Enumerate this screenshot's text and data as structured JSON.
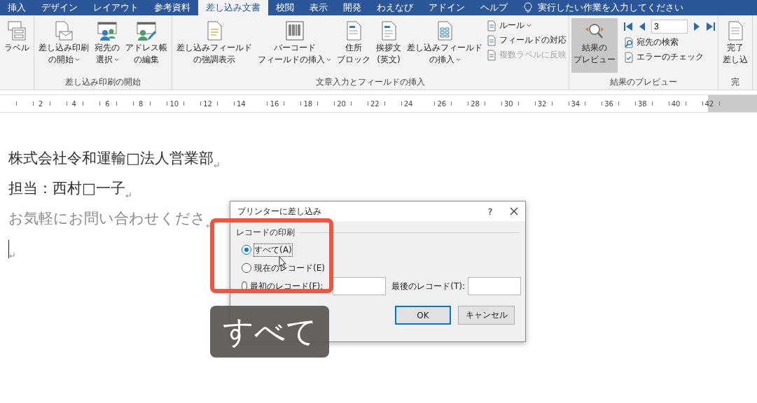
{
  "tabs": [
    {
      "label": "挿入",
      "selected": false
    },
    {
      "label": "デザイン",
      "selected": false
    },
    {
      "label": "レイアウト",
      "selected": false
    },
    {
      "label": "参考資料",
      "selected": false
    },
    {
      "label": "差し込み文書",
      "selected": true
    },
    {
      "label": "校閲",
      "selected": false
    },
    {
      "label": "表示",
      "selected": false
    },
    {
      "label": "開発",
      "selected": false
    },
    {
      "label": "わえなび",
      "selected": false
    },
    {
      "label": "アドイン",
      "selected": false
    },
    {
      "label": "ヘルプ",
      "selected": false
    }
  ],
  "tell_me": "実行したい作業を入力してください",
  "ribbon": [
    {
      "items": [
        {
          "kind": "large",
          "lines": [
            "ラベル"
          ],
          "dropdown": false,
          "pressed": false
        }
      ]
    },
    {
      "label": "差し込み印刷の開始",
      "items": [
        {
          "kind": "large",
          "lines": [
            "差し込み印刷",
            "の開始"
          ],
          "dropdown": true,
          "pressed": false
        },
        {
          "kind": "large",
          "lines": [
            "宛先の",
            "選択"
          ],
          "dropdown": true,
          "pressed": false
        },
        {
          "kind": "large",
          "lines": [
            "アドレス帳",
            "の編集"
          ],
          "dropdown": false,
          "pressed": false
        }
      ]
    },
    {
      "label": "文章入力とフィールドの挿入",
      "items": [
        {
          "kind": "large",
          "lines": [
            "差し込みフィールド",
            "の強調表示"
          ],
          "dropdown": false,
          "pressed": false
        },
        {
          "kind": "large",
          "lines": [
            "バーコード",
            "フィールドの挿入"
          ],
          "dropdown": true,
          "pressed": false
        },
        {
          "kind": "large",
          "lines": [
            "住所",
            "ブロック"
          ],
          "dropdown": false,
          "pressed": false
        },
        {
          "kind": "large",
          "lines": [
            "挨拶文",
            "(英文)"
          ],
          "dropdown": false,
          "pressed": false
        },
        {
          "kind": "large",
          "lines": [
            "差し込みフィールド",
            "の挿入"
          ],
          "dropdown": true,
          "pressed": false
        },
        {
          "kind": "small",
          "entries": [
            {
              "label": "ルール",
              "dropdown": true,
              "disabled": false
            },
            {
              "label": "フィールドの対応",
              "dropdown": false,
              "disabled": false
            },
            {
              "label": "複数ラベルに反映",
              "dropdown": false,
              "disabled": true
            }
          ]
        }
      ]
    },
    {
      "label": "結果のプレビュー",
      "items": [
        {
          "kind": "large",
          "lines": [
            "結果の",
            "プレビュー"
          ],
          "dropdown": false,
          "pressed": true
        },
        {
          "kind": "preview",
          "record": "3",
          "entries": [
            {
              "label": "宛先の検索",
              "disabled": false
            },
            {
              "label": "エラーのチェック",
              "disabled": false
            }
          ]
        }
      ]
    },
    {
      "label": "完",
      "items": [
        {
          "kind": "large",
          "lines": [
            "完了",
            "差し込"
          ],
          "dropdown": false,
          "pressed": false
        }
      ]
    }
  ],
  "ruler": [
    "2",
    "4",
    "6",
    "8",
    "10",
    "12",
    "14",
    "16",
    "18",
    "20",
    "22",
    "24",
    "26",
    "28",
    "30",
    "32",
    "34",
    "36",
    "38",
    "40",
    "42"
  ],
  "document": [
    {
      "kind": "text",
      "text": "株式会社令和運輸□法人営業部"
    },
    {
      "kind": "text",
      "text": "担当：西村□一子"
    },
    {
      "kind": "faint",
      "text": "お気軽にお問い合わせくださ"
    },
    {
      "kind": "cursor"
    }
  ],
  "dialog": {
    "title": "プリンターに差し込み",
    "help": "?",
    "group": "レコードの印刷",
    "options": [
      {
        "label": "すべて(A)",
        "selected": true
      },
      {
        "label": "現在のレコード(E)",
        "selected": false
      },
      {
        "label": "最初のレコード(F):",
        "selected": false
      }
    ],
    "last_label": "最後のレコード(T):",
    "buttons": [
      {
        "label": "OK",
        "default": true
      },
      {
        "label": "キャンセル",
        "default": false
      }
    ]
  },
  "caption": "すべて"
}
